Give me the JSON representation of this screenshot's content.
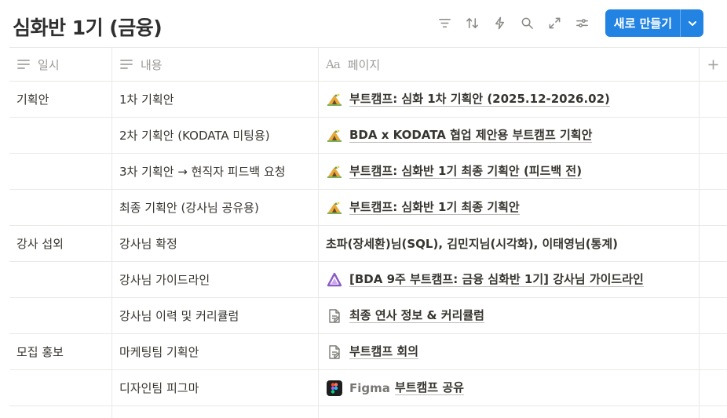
{
  "title": "심화반 1기 (금융)",
  "toolbar": {
    "icons": [
      "filter-icon",
      "sort-icon",
      "automation-icon",
      "search-icon",
      "expand-icon",
      "settings-icon"
    ],
    "new_button_label": "새로 만들기",
    "accent": "#2383e2"
  },
  "columns": {
    "date": "일시",
    "content": "내용",
    "page": "페이지"
  },
  "rows": [
    {
      "group": "기획안",
      "content": "1차 기획안",
      "page": {
        "icon": "camping-icon",
        "text": "부트캠프: 심화 1차 기획안 (2025.12-2026.02)"
      }
    },
    {
      "group": "",
      "content": "2차 기획안 (KODATA 미팅용)",
      "page": {
        "icon": "camping-icon",
        "text": "BDA x KODATA 협업 제안용 부트캠프 기획안"
      }
    },
    {
      "group": "",
      "content": "3차 기획안 → 현직자 피드백 요청",
      "page": {
        "icon": "camping-icon",
        "text": "부트캠프: 심화반 1기 최종 기획안 (피드백 전)"
      }
    },
    {
      "group": "",
      "content": "최종 기획안 (강사님 공유용)",
      "page": {
        "icon": "camping-icon",
        "text": "부트캠프: 심화반 1기 최종 기획안"
      }
    },
    {
      "group": "강사 섭외",
      "content": "강사님 확정",
      "page": {
        "icon": "",
        "text": "초파(장세환)님(SQL), 김민지님(시각화), 이태영님(통계)"
      }
    },
    {
      "group": "",
      "content": "강사님 가이드라인",
      "page": {
        "icon": "triangle-logo-icon",
        "text": "[BDA 9주 부트캠프: 금융 심화반 1기] 강사님 가이드라인"
      }
    },
    {
      "group": "",
      "content": "강사님 이력 및 커리큘럼",
      "page": {
        "icon": "document-icon",
        "text": "최종 연사 정보 & 커리큘럼"
      }
    },
    {
      "group": "모집 홍보",
      "content": "마케팅팀 기획안",
      "page": {
        "icon": "document-icon",
        "text": "부트캠프 회의"
      }
    },
    {
      "group": "",
      "content": "디자인팀 피그마",
      "page": {
        "icon": "figma-icon",
        "prefix": "Figma",
        "text": "부트캠프 공유"
      }
    }
  ]
}
